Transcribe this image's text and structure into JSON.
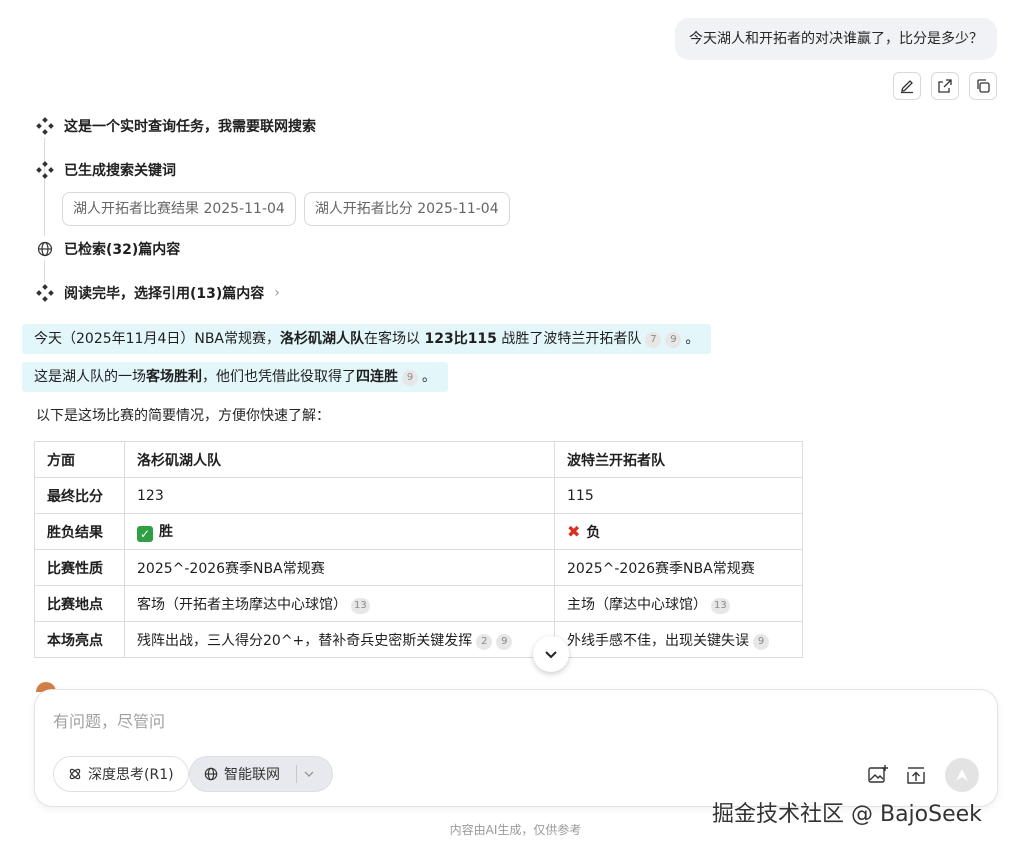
{
  "user_message": "今天湖人和开拓者的对决谁赢了，比分是多少？",
  "message_actions": [
    "edit-icon",
    "share-icon",
    "copy-icon"
  ],
  "steps": {
    "step1": "这是一个实时查询任务，我需要联网搜索",
    "step2": "已生成搜索关键词",
    "keywords": [
      "湖人开拓者比赛结果 2025-11-04",
      "湖人开拓者比分 2025-11-04"
    ],
    "step3": "已检索(32)篇内容",
    "step4": "阅读完毕，选择引用(13)篇内容"
  },
  "answer": {
    "line1": {
      "pre": "今天（2025年11月4日）NBA常规赛，",
      "b1": "洛杉矶湖人队",
      "mid": "在客场以 ",
      "b2": "123比115",
      "post": " 战胜了波特兰开拓者队",
      "cites": [
        "7",
        "9"
      ],
      "end": "。"
    },
    "line2": {
      "pre": "这是湖人队的一场",
      "b1": "客场胜利",
      "mid": "，他们也凭借此役取得了",
      "b2": "四连胜",
      "cites": [
        "9"
      ],
      "end": "。"
    },
    "intro": "以下是这场比赛的简要情况，方便你快速了解："
  },
  "table": {
    "headers": [
      "方面",
      "洛杉矶湖人队",
      "波特兰开拓者队"
    ],
    "rows": [
      {
        "label": "最终比分",
        "lakers": "123",
        "blazers": "115"
      },
      {
        "label": "胜负结果",
        "lakers": "胜",
        "blazers": "负"
      },
      {
        "label": "比赛性质",
        "lakers": "2025^-2026赛季NBA常规赛",
        "blazers": "2025^-2026赛季NBA常规赛"
      },
      {
        "label": "比赛地点",
        "lakers": "客场（开拓者主场摩达中心球馆）",
        "lakers_cites": [
          "13"
        ],
        "blazers": "主场（摩达中心球馆）",
        "blazers_cites": [
          "13"
        ]
      },
      {
        "label": "本场亮点",
        "lakers": "残阵出战，三人得分20^+，替补奇兵史密斯关键发挥",
        "lakers_cites": [
          "2",
          "9"
        ],
        "blazers": "外线手感不佳，出现关键失误",
        "blazers_cites": [
          "9"
        ]
      }
    ]
  },
  "composer": {
    "placeholder": "有问题，尽管问",
    "deep_think": "深度思考(R1)",
    "web_search": "智能联网"
  },
  "watermark": "掘金技术社区 @ BajoSeek",
  "disclaimer": "内容由AI生成，仅供参考"
}
